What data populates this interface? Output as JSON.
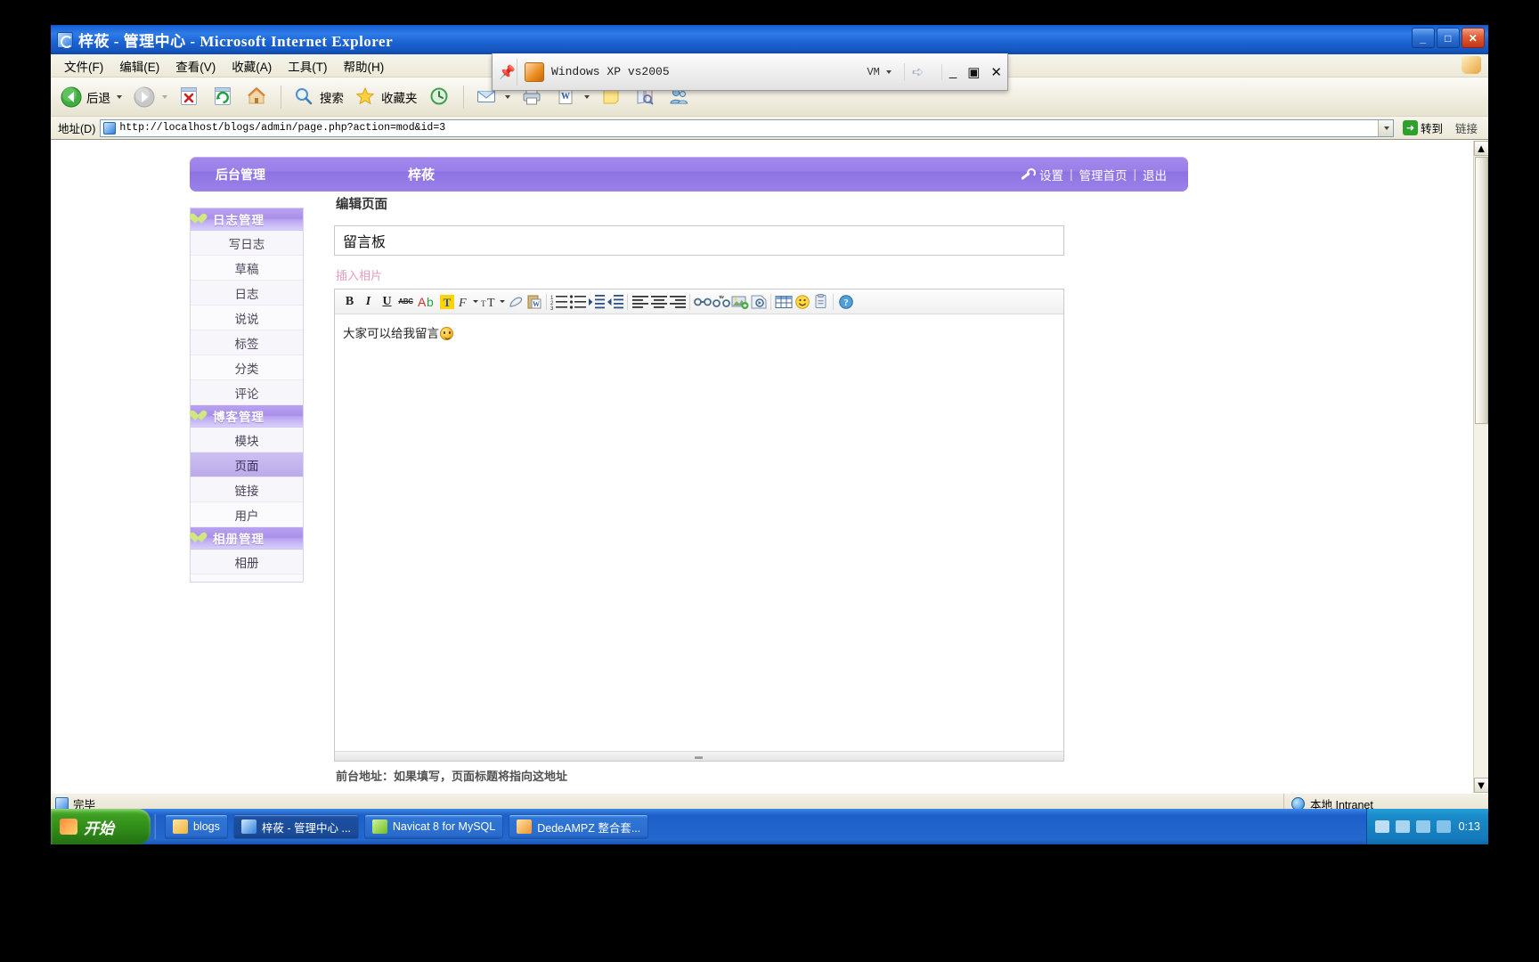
{
  "ie": {
    "title": "梓莜 - 管理中心 - Microsoft Internet Explorer",
    "window_buttons": {
      "minimize": "_",
      "maximize": "□",
      "close": "✕"
    },
    "menu": [
      "文件(F)",
      "编辑(E)",
      "查看(V)",
      "收藏(A)",
      "工具(T)",
      "帮助(H)"
    ],
    "toolbar": {
      "back": "后退",
      "forward": "",
      "stop": "",
      "refresh": "",
      "home": "",
      "search": "搜索",
      "favorites": "收藏夹",
      "history": "",
      "mail": "",
      "print": "",
      "edit": "",
      "notes": "",
      "research": "",
      "messenger": ""
    },
    "address": {
      "label": "地址(D)",
      "url": "http://localhost/blogs/admin/page.php?action=mod&id=3",
      "go": "转到",
      "links": "链接"
    },
    "status": {
      "text": "完毕",
      "zone": "本地 Intranet"
    }
  },
  "vm": {
    "title": "Windows XP vs2005",
    "menu_label": "VM",
    "minimize": "_",
    "restore": "▣",
    "close": "✕"
  },
  "blog": {
    "header": {
      "admin_label": "后台管理",
      "site_title": "梓莜",
      "settings": "设置",
      "sep1": "|",
      "admin_home": "管理首页",
      "sep2": "|",
      "logout": "退出"
    },
    "sidebar": [
      {
        "type": "section",
        "label": "日志管理",
        "items": [
          {
            "label": "写日志",
            "active": false
          },
          {
            "label": "草稿",
            "active": false
          },
          {
            "label": "日志",
            "active": false
          },
          {
            "label": "说说",
            "active": false
          },
          {
            "label": "标签",
            "active": false
          },
          {
            "label": "分类",
            "active": false
          },
          {
            "label": "评论",
            "active": false
          }
        ]
      },
      {
        "type": "section",
        "label": "博客管理",
        "items": [
          {
            "label": "模块",
            "active": false
          },
          {
            "label": "页面",
            "active": true
          },
          {
            "label": "链接",
            "active": false
          },
          {
            "label": "用户",
            "active": false
          }
        ]
      },
      {
        "type": "section",
        "label": "相册管理",
        "items": [
          {
            "label": "相册",
            "active": false
          }
        ]
      }
    ],
    "main": {
      "page_title": "编辑页面",
      "title_value": "留言板",
      "insert_photo": "插入相片",
      "editor_content": "大家可以给我留言",
      "below_text": "前台地址：如果填写，页面标题将指向这地址"
    },
    "editor_toolbar": [
      {
        "name": "bold-icon",
        "glyph": "B"
      },
      {
        "name": "italic-icon",
        "glyph": "I"
      },
      {
        "name": "underline-icon",
        "glyph": "U"
      },
      {
        "name": "strikethrough-icon",
        "glyph": "ABC"
      },
      {
        "name": "text-color-icon",
        "glyph": "Ab"
      },
      {
        "name": "highlight-color-icon",
        "glyph": "T"
      },
      {
        "name": "font-family-icon",
        "glyph": "F"
      },
      {
        "name": "font-size-icon",
        "glyph": "T"
      },
      {
        "name": "remove-format-icon",
        "glyph": ""
      },
      {
        "name": "paste-from-word-icon",
        "glyph": ""
      },
      {
        "name": "ordered-list-icon",
        "glyph": ""
      },
      {
        "name": "unordered-list-icon",
        "glyph": ""
      },
      {
        "name": "indent-icon",
        "glyph": ""
      },
      {
        "name": "outdent-icon",
        "glyph": ""
      },
      {
        "name": "align-left-icon",
        "glyph": ""
      },
      {
        "name": "align-center-icon",
        "glyph": ""
      },
      {
        "name": "align-right-icon",
        "glyph": ""
      },
      {
        "name": "insert-link-icon",
        "glyph": ""
      },
      {
        "name": "remove-link-icon",
        "glyph": ""
      },
      {
        "name": "insert-image-icon",
        "glyph": ""
      },
      {
        "name": "insert-flash-icon",
        "glyph": ""
      },
      {
        "name": "insert-table-icon",
        "glyph": ""
      },
      {
        "name": "insert-emoticon-icon",
        "glyph": ""
      },
      {
        "name": "insert-attachment-icon",
        "glyph": ""
      },
      {
        "name": "help-icon",
        "glyph": "?"
      }
    ]
  },
  "taskbar": {
    "start": "开始",
    "items": [
      {
        "label": "blogs",
        "icon": "folder-icon",
        "active": false,
        "color": "#f2c45a"
      },
      {
        "label": "梓莜 - 管理中心 ...",
        "icon": "ie-icon",
        "active": true,
        "color": "#6bb8ee"
      },
      {
        "label": "Navicat 8 for MySQL",
        "icon": "navicat-icon",
        "active": false,
        "color": "#8fd44a"
      },
      {
        "label": "DedeAMPZ 整合套...",
        "icon": "dedeampz-icon",
        "active": false,
        "color": "#ffb54a"
      }
    ],
    "clock": "0:13"
  },
  "colors": {
    "brand_purple": "#9a7fe8",
    "sidebar_head": "#a98ee9",
    "accent_pink": "#e79ac0",
    "taskbar_blue": "#2a72d8",
    "start_green": "#3d9e22"
  }
}
